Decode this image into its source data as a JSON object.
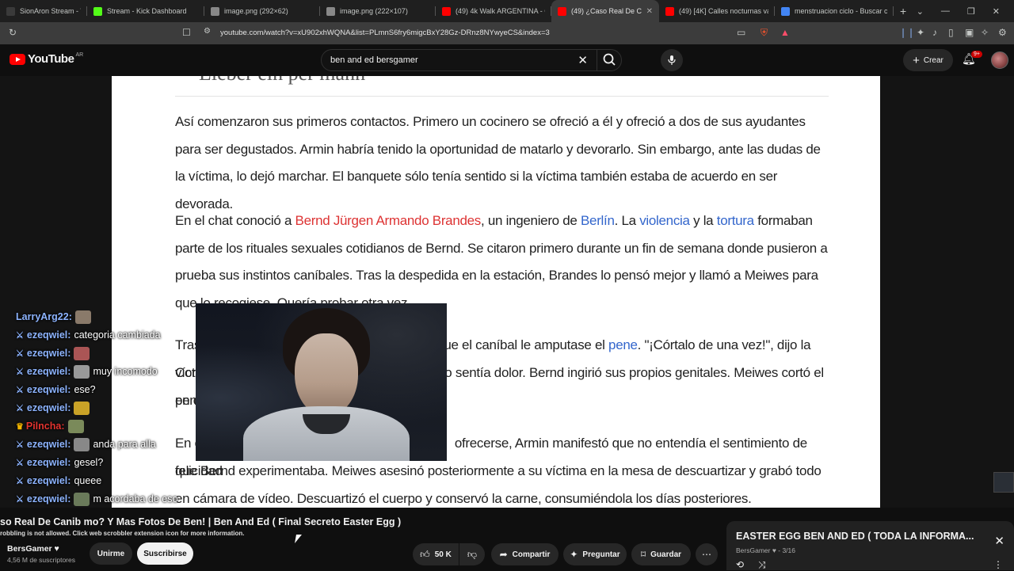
{
  "browser": {
    "tabs": [
      {
        "title": "SionAron Stream - Watch",
        "favicon_color": "#3a3a3a",
        "active": false
      },
      {
        "title": "Stream - Kick Dashboard",
        "favicon_color": "#53fc18",
        "active": false
      },
      {
        "title": "image.png (292×62)",
        "favicon_color": "#888888",
        "active": false
      },
      {
        "title": "image.png (222×107)",
        "favicon_color": "#888888",
        "active": false
      },
      {
        "title": "(49) 4k Walk ARGENTINA - CO",
        "favicon_color": "#ff0000",
        "active": false
      },
      {
        "title": "(49) ¿Caso Real De Ca",
        "favicon_color": "#ff0000",
        "active": true
      },
      {
        "title": "(49) [4K] Calles nocturnas vac",
        "favicon_color": "#ff0000",
        "active": false
      },
      {
        "title": "menstruacion ciclo - Buscar co",
        "favicon_color": "#4285f4",
        "active": false
      }
    ],
    "new_tab_icon": "plus-icon",
    "url": "youtube.com/watch?v=xU902xhWQNA&list=PLmnS6fry6migcBxY28Gz-DRnz8NYwyeCS&index=3"
  },
  "youtube": {
    "logo_text": "YouTube",
    "country_code": "AR",
    "search_query": "ben and ed bersgamer",
    "create_label": "Crear",
    "notif_count": "9+"
  },
  "document": {
    "paragraphs": [
      {
        "segments": [
          {
            "text": "Así comenzaron sus primeros contactos. Primero un cocinero se ofreció a él y ofreció a dos de sus ayudantes para ser degustados. Armin habría tenido la oportunidad de matarlo y devorarlo. Sin embargo, ante las dudas de la víctima, lo dejó marchar. El banquete sólo tenía sentido si la víctima también estaba de acuerdo en ser devorada.",
            "link": ""
          }
        ]
      },
      {
        "segments": [
          {
            "text": "En el chat conoció a ",
            "link": ""
          },
          {
            "text": "Bernd Jürgen Armando Brandes",
            "link": "red"
          },
          {
            "text": ", un ingeniero de ",
            "link": ""
          },
          {
            "text": "Berlín",
            "link": "blue"
          },
          {
            "text": ". La ",
            "link": ""
          },
          {
            "text": "violencia",
            "link": "blue"
          },
          {
            "text": " y la ",
            "link": ""
          },
          {
            "text": "tortura",
            "link": "blue"
          },
          {
            "text": " formaban parte de los rituales sexuales cotidianos de Bernd. Se citaron primero durante un fin de semana donde pusieron a prueba sus instintos caníbales. Tras la despedida en la estación, Brandes lo pensó mejor y llamó a Meiwes para que lo recogiese. Quería probar otra vez.",
            "link": ""
          }
        ]
      },
      {
        "segments": [
          {
            "text": "Tras",
            "link": ""
          },
          {
            "text": "que el caníbal le amputase el ",
            "link": ""
          },
          {
            "text": "pene",
            "link": "blue"
          },
          {
            "text": ". \"¡Córtalo de una vez!\", dijo la víctima.",
            "link": ""
          }
        ]
      },
      {
        "segments": [
          {
            "text": "Con",
            "link": ""
          },
          {
            "text": "o sentía dolor. Bernd ingirió sus propios genitales. Meiwes cortó el pene",
            "link": ""
          }
        ]
      },
      {
        "segments": [
          {
            "text": "en c",
            "link": ""
          }
        ]
      },
      {
        "segments": [
          {
            "text": "En c",
            "link": ""
          },
          {
            "text": "ofrecerse, Armin manifestó que no entendía el sentimiento de felicidad",
            "link": ""
          }
        ]
      },
      {
        "segments": [
          {
            "text": "que Bernd experimentaba. Meiwes asesinó posteriormente a su víctima en la mesa de descuartizar y grabó todo en cámara de vídeo. Descuartizó el cuerpo y conservó la carne, consumiéndola los días posteriores.",
            "link": ""
          }
        ]
      }
    ]
  },
  "chat": [
    {
      "user": "LarryArg22:",
      "text": "",
      "badge": "none",
      "user_color": "#8db4ff",
      "emote": true
    },
    {
      "user": "ezeqwiel:",
      "text": "categoria cambiada",
      "badge": "sword",
      "user_color": "#8db4ff",
      "emote": false
    },
    {
      "user": "ezeqwiel:",
      "text": "",
      "badge": "sword",
      "user_color": "#8db4ff",
      "emote": true
    },
    {
      "user": "ezeqwiel:",
      "text": "muy incomodo",
      "badge": "sword",
      "user_color": "#8db4ff",
      "emote": true
    },
    {
      "user": "ezeqwiel:",
      "text": "ese?",
      "badge": "sword",
      "user_color": "#8db4ff",
      "emote": false
    },
    {
      "user": "ezeqwiel:",
      "text": "",
      "badge": "sword",
      "user_color": "#8db4ff",
      "emote": true
    },
    {
      "user": "Pilncha:",
      "text": "",
      "badge": "crown",
      "user_color": "#e3342f",
      "emote": true
    },
    {
      "user": "ezeqwiel:",
      "text": "anda para alla",
      "badge": "sword",
      "user_color": "#8db4ff",
      "emote": true
    },
    {
      "user": "ezeqwiel:",
      "text": "gesel?",
      "badge": "sword",
      "user_color": "#8db4ff",
      "emote": false
    },
    {
      "user": "ezeqwiel:",
      "text": "queee",
      "badge": "sword",
      "user_color": "#8db4ff",
      "emote": false
    },
    {
      "user": "ezeqwiel:",
      "text": "m acordaba de eso",
      "badge": "sword",
      "user_color": "#8db4ff",
      "emote": true
    },
    {
      "user": "LarryArg22:",
      "text": "",
      "badge": "none",
      "user_color": "#8db4ff",
      "emote": true
    }
  ],
  "video_info": {
    "title": "so Real De Canib mo? Y Mas Fotos De Ben! | Ben And Ed ( Final Secreto Easter Egg )",
    "scrobble_note": "robbling is not allowed. Click web scrobbler extension icon for more information.",
    "channel": "BersGamer ♥",
    "subscribers": "4,56 M de suscriptores",
    "join_label": "Unirme",
    "subscribe_label": "Suscribirse",
    "like_count": "50 K",
    "share_label": "Compartir",
    "ask_label": "Preguntar",
    "save_label": "Guardar"
  },
  "playlist": {
    "title": "EASTER EGG BEN AND ED ( TODA LA INFORMA...",
    "channel": "BersGamer ♥",
    "position": "3/16"
  }
}
